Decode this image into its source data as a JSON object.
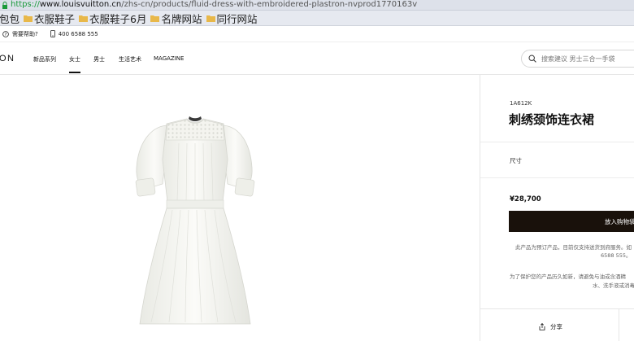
{
  "browser": {
    "url_scheme": "https://",
    "url_host": "www.louisvuitton.cn",
    "url_path": "/zhs-cn/products/fluid-dress-with-embroidered-plastron-nvprod1770163v"
  },
  "bookmarks": [
    {
      "label": "包包"
    },
    {
      "label": "衣服鞋子"
    },
    {
      "label": "衣服鞋子6月"
    },
    {
      "label": "名牌网站"
    },
    {
      "label": "同行网站"
    }
  ],
  "utility": {
    "help_label": "需要帮助?",
    "phone": "400 6588 555"
  },
  "nav": {
    "logo": "ON",
    "links": [
      "新品系列",
      "女士",
      "男士",
      "生活艺术",
      "MAGAZINE"
    ],
    "active_index": 1,
    "search_placeholder": "搜索建议 男士三合一手袋"
  },
  "product": {
    "sku": "1A612K",
    "title": "刺绣颈饰连衣裙",
    "size_label": "尺寸",
    "price": "¥28,700",
    "cta_label": "放入购物袋",
    "note1_line1": "此产品为预订产品，目前仅支持送货到府服务。如",
    "note1_line2": "6588 555。",
    "note2_line1": "为了保护您的产品历久如新，请避免与油或含酒精",
    "note2_line2": "水、洗手液或消毒",
    "share_label": "分享"
  },
  "colors": {
    "cta_bg": "#19110b",
    "url_scheme": "#1a9a3a",
    "folder": "#e8b84a"
  }
}
